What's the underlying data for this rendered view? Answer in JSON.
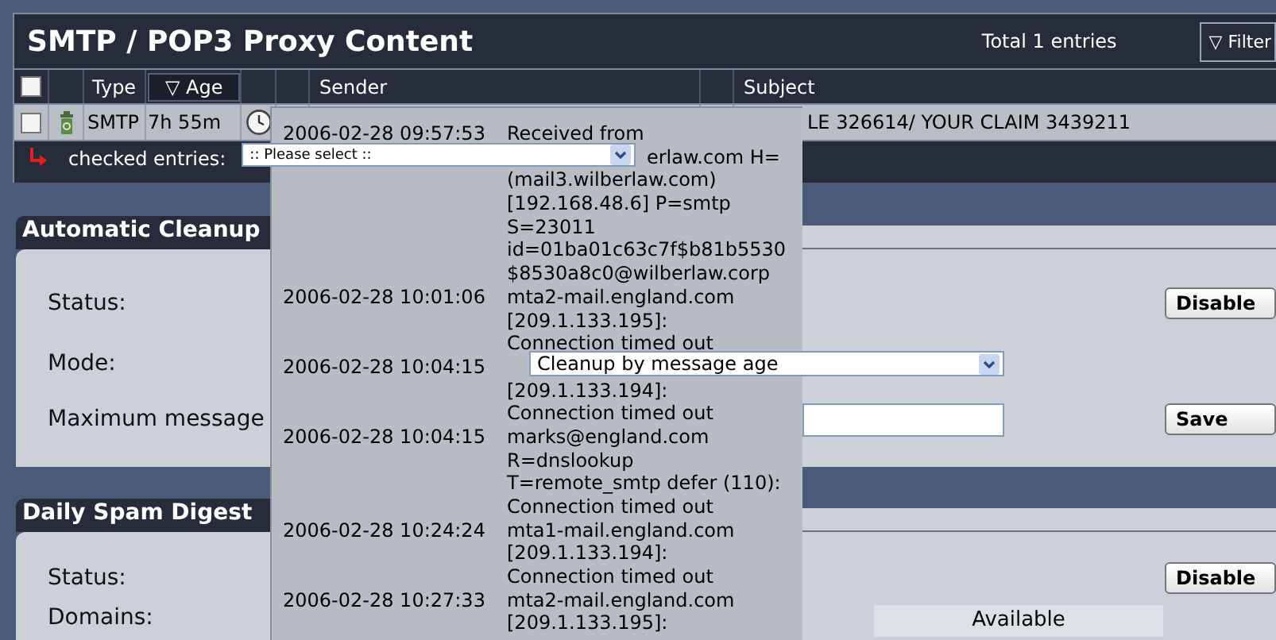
{
  "title": "SMTP / POP3 Proxy Content",
  "total": "Total 1 entries",
  "filter_button": "▽ Filter",
  "table": {
    "select_all_checked": false,
    "columns": [
      {
        "label": "Type",
        "sorted": false
      },
      {
        "label": "▽ Age",
        "sorted": true
      },
      {
        "label": "Sender",
        "sorted": false
      },
      {
        "label": "Subject",
        "sorted": false
      }
    ],
    "rows": [
      {
        "checked": false,
        "type": "SMTP",
        "age": "7h 55m",
        "subject": "LE 326614/ YOUR CLAIM 3439211"
      }
    ]
  },
  "bulk_action": {
    "label": "checked entries:",
    "value": ":: Please select ::"
  },
  "tooltip": [
    {
      "time": "2006-02-28 09:57:53",
      "lines": [
        {
          "text": "Received from",
          "kind": "full"
        },
        {
          "text": "erlaw.com H=",
          "kind": "tail"
        },
        {
          "text": "(mail3.wilberlaw.com)",
          "kind": "full"
        },
        {
          "text": "[192.168.48.6] P=smtp",
          "kind": "full"
        },
        {
          "text": "S=23011",
          "kind": "full"
        },
        {
          "text": "id=01ba01c63c7f$b81b5530",
          "kind": "full"
        },
        {
          "text": "$8530a8c0@wilberlaw.corp",
          "kind": "full"
        }
      ]
    },
    {
      "time": "2006-02-28 10:01:06",
      "lines": [
        {
          "text": "mta2-mail.england.com",
          "kind": "full"
        },
        {
          "text": "[209.1.133.195]:",
          "kind": "full"
        },
        {
          "text": "Connection timed out",
          "kind": "full"
        }
      ]
    },
    {
      "time": "2006-02-28 10:04:15",
      "lines": [
        {
          "kind": "hidden"
        },
        {
          "text": "[209.1.133.194]:",
          "kind": "full"
        },
        {
          "text": "Connection timed out",
          "kind": "full"
        }
      ]
    },
    {
      "time": "2006-02-28 10:04:15",
      "lines": [
        {
          "text": "marks@england.com",
          "kind": "full"
        },
        {
          "text": "R=dnslookup",
          "kind": "full"
        },
        {
          "text": "T=remote_smtp defer (110):",
          "kind": "full"
        },
        {
          "text": "Connection timed out",
          "kind": "full"
        }
      ]
    },
    {
      "time": "2006-02-28 10:24:24",
      "lines": [
        {
          "text": "mta1-mail.england.com",
          "kind": "full"
        },
        {
          "text": "[209.1.133.194]:",
          "kind": "full"
        },
        {
          "text": "Connection timed out",
          "kind": "full"
        }
      ]
    },
    {
      "time": "2006-02-28 10:27:33",
      "lines": [
        {
          "text": "mta2-mail.england.com",
          "kind": "full"
        },
        {
          "text": "[209.1.133.195]:",
          "kind": "full"
        }
      ]
    }
  ],
  "cleanup": {
    "title": "Automatic Cleanup",
    "status_label": "Status:",
    "disable_button": "Disable",
    "mode_label": "Mode:",
    "mode_value": "Cleanup by message age",
    "max_label": "Maximum message",
    "save_button": "Save"
  },
  "digest": {
    "title": "Daily Spam Digest",
    "status_label": "Status:",
    "disable_button": "Disable",
    "domains_label": "Domains:",
    "available_header": "Available"
  }
}
